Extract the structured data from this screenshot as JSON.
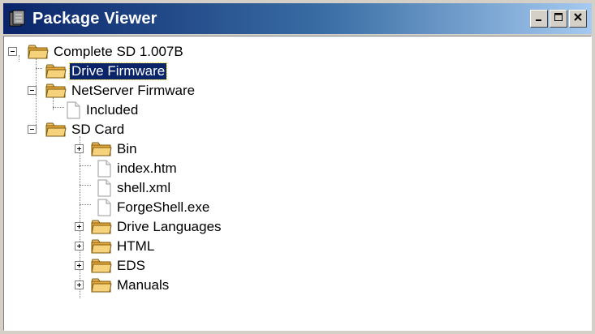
{
  "window": {
    "title": "Package Viewer",
    "title_color": "#ffffff",
    "titlebar_color": "#0a246a",
    "controls": [
      "minimize-icon",
      "maximize-icon",
      "close-icon"
    ]
  },
  "tree": {
    "root": {
      "label": "Complete SD  1.007B",
      "icon": "folder-icon",
      "expanded": true
    },
    "drive_firmware": {
      "label": "Drive Firmware",
      "icon": "folder-icon",
      "selected": true
    },
    "netserver_firmware": {
      "label": "NetServer Firmware",
      "icon": "folder-icon",
      "expanded": true
    },
    "included": {
      "label": "Included",
      "icon": "file-icon"
    },
    "sd_card": {
      "label": "SD Card",
      "icon": "folder-icon",
      "expanded": true
    },
    "bin": {
      "label": "Bin",
      "icon": "folder-icon",
      "expanded": false
    },
    "index_htm": {
      "label": "index.htm",
      "icon": "file-icon"
    },
    "shell_xml": {
      "label": "shell.xml",
      "icon": "file-icon"
    },
    "forgeshell_exe": {
      "label": "ForgeShell.exe",
      "icon": "file-icon"
    },
    "drive_languages": {
      "label": "Drive Languages",
      "icon": "folder-icon",
      "expanded": false
    },
    "html": {
      "label": "HTML",
      "icon": "folder-icon",
      "expanded": false
    },
    "eds": {
      "label": "EDS",
      "icon": "folder-icon",
      "expanded": false
    },
    "manuals": {
      "label": "Manuals",
      "icon": "folder-icon",
      "expanded": false
    },
    "selection_color": "#0a246a",
    "folder_color": "#f2c063"
  }
}
